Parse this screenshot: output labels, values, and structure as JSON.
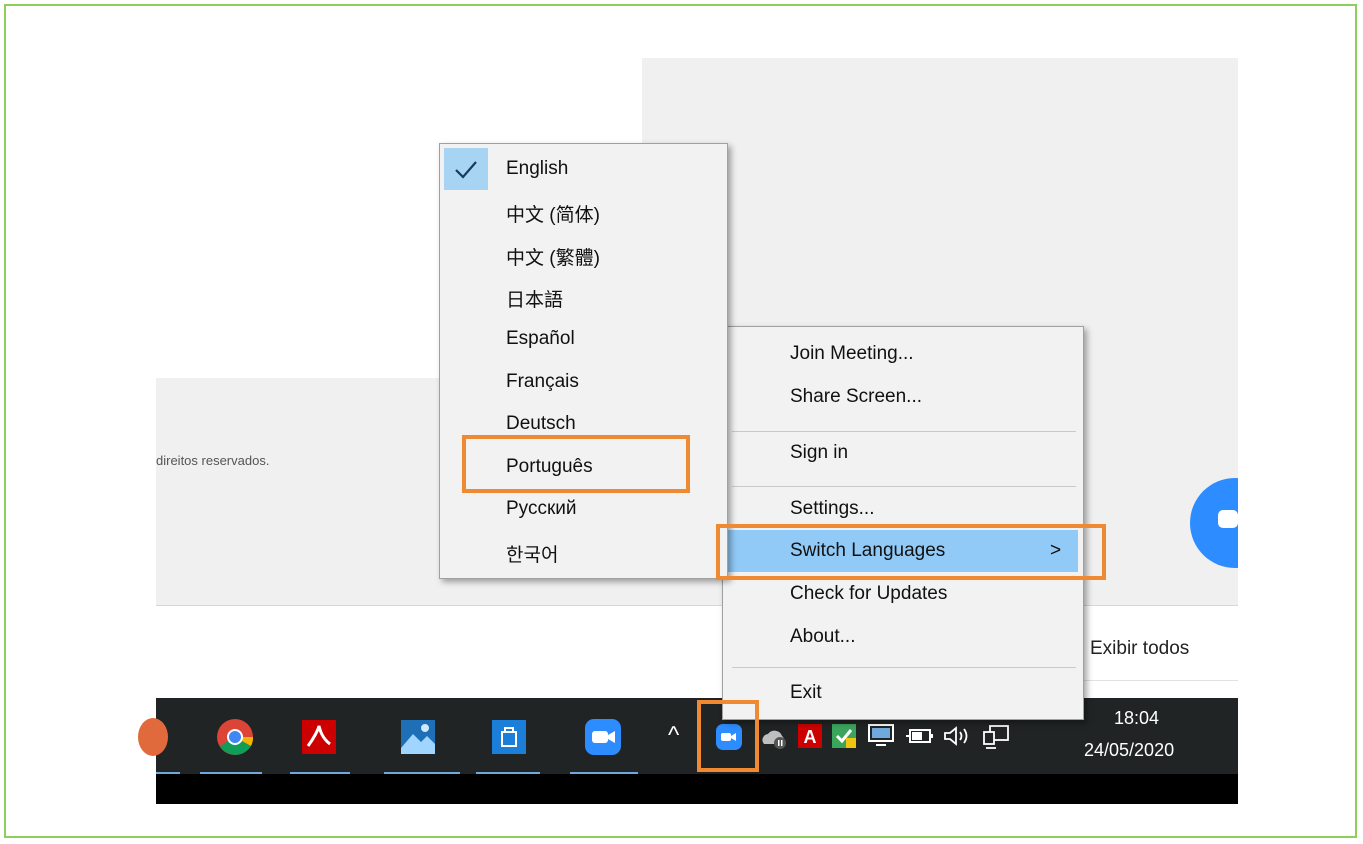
{
  "background": {
    "copyright_fragment": "direitos reservados.",
    "show_all_link": "Exibir todos"
  },
  "language_menu": {
    "items": [
      {
        "label": "English",
        "checked": true
      },
      {
        "label": "中文 (简体)"
      },
      {
        "label": "中文 (繁體)"
      },
      {
        "label": "日本語"
      },
      {
        "label": "Español"
      },
      {
        "label": "Français"
      },
      {
        "label": "Deutsch"
      },
      {
        "label": "Português"
      },
      {
        "label": "Русский"
      },
      {
        "label": "한국어"
      }
    ]
  },
  "tray_menu": {
    "join": "Join Meeting...",
    "share": "Share Screen...",
    "signin": "Sign in",
    "settings": "Settings...",
    "switch_lang": "Switch Languages",
    "switch_arrow": ">",
    "updates": "Check for Updates",
    "about": "About...",
    "exit": "Exit"
  },
  "taskbar": {
    "time": "18:04",
    "date": "24/05/2020",
    "chevron": "^",
    "apps": [
      "chrome-icon",
      "acrobat-icon",
      "photos-icon",
      "store-icon",
      "zoom-icon"
    ],
    "tray_icons": [
      "zoom-tray-icon",
      "cloud-paused-icon",
      "acrobat-tray-icon",
      "security-icon",
      "display-icon",
      "battery-icon",
      "volume-icon",
      "network-icon"
    ]
  },
  "colors": {
    "highlight_orange": "#f08a32",
    "menu_selection": "#91c9f7",
    "zoom_blue": "#2d8cff",
    "frame_green": "#8dcf5a"
  }
}
